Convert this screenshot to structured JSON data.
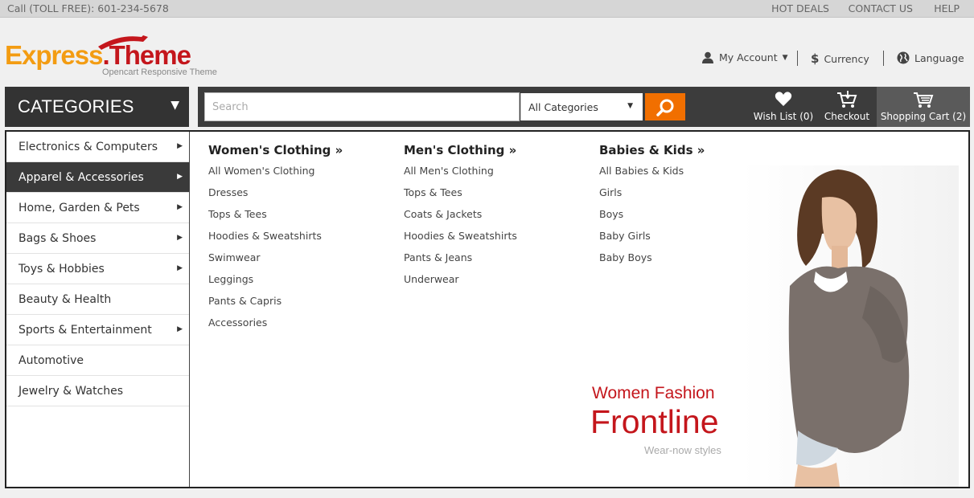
{
  "topbar": {
    "phone": "Call (TOLL FREE): 601-234-5678",
    "links": [
      "HOT DEALS",
      "CONTACT US",
      "HELP"
    ]
  },
  "logo": {
    "word1": "Express",
    "word2": ".Theme",
    "tagline": "Opencart Responsive Theme"
  },
  "account": {
    "my_account": "My Account",
    "currency": "Currency",
    "language": "Language"
  },
  "categories_button": {
    "label": "CATEGORIES"
  },
  "search": {
    "placeholder": "Search",
    "category_selected": "All Categories"
  },
  "nav": {
    "wishlist": "Wish List (0)",
    "checkout": "Checkout",
    "cart": "Shopping Cart (2)"
  },
  "category_list": [
    {
      "label": "Electronics & Computers",
      "has_sub": true,
      "active": false
    },
    {
      "label": "Apparel & Accessories",
      "has_sub": true,
      "active": true
    },
    {
      "label": "Home, Garden & Pets",
      "has_sub": true,
      "active": false
    },
    {
      "label": "Bags & Shoes",
      "has_sub": true,
      "active": false
    },
    {
      "label": "Toys & Hobbies",
      "has_sub": true,
      "active": false
    },
    {
      "label": "Beauty & Health",
      "has_sub": false,
      "active": false
    },
    {
      "label": "Sports & Entertainment",
      "has_sub": true,
      "active": false
    },
    {
      "label": "Automotive",
      "has_sub": false,
      "active": false
    },
    {
      "label": "Jewelry & Watches",
      "has_sub": false,
      "active": false
    }
  ],
  "submenu": {
    "womens": {
      "heading": "Women's Clothing »",
      "items": [
        "All Women's Clothing",
        "Dresses",
        "Tops & Tees",
        "Hoodies & Sweatshirts",
        "Swimwear",
        "Leggings",
        "Pants & Capris",
        "Accessories"
      ]
    },
    "mens": {
      "heading": "Men's Clothing »",
      "items": [
        "All Men's Clothing",
        "Tops & Tees",
        "Coats & Jackets",
        "Hoodies & Sweatshirts",
        "Pants & Jeans",
        "Underwear"
      ]
    },
    "kids": {
      "heading": "Babies & Kids »",
      "items": [
        "All Babies & Kids",
        "Girls",
        "Boys",
        "Baby Girls",
        "Baby Boys"
      ]
    }
  },
  "promo": {
    "line1": "Women Fashion",
    "line2": "Frontline",
    "line3": "Wear-now styles"
  },
  "colors": {
    "accent_orange": "#f16f00",
    "logo_red": "#c4161c",
    "logo_orange": "#f39c12",
    "dark_bar": "#3c3c3c"
  }
}
